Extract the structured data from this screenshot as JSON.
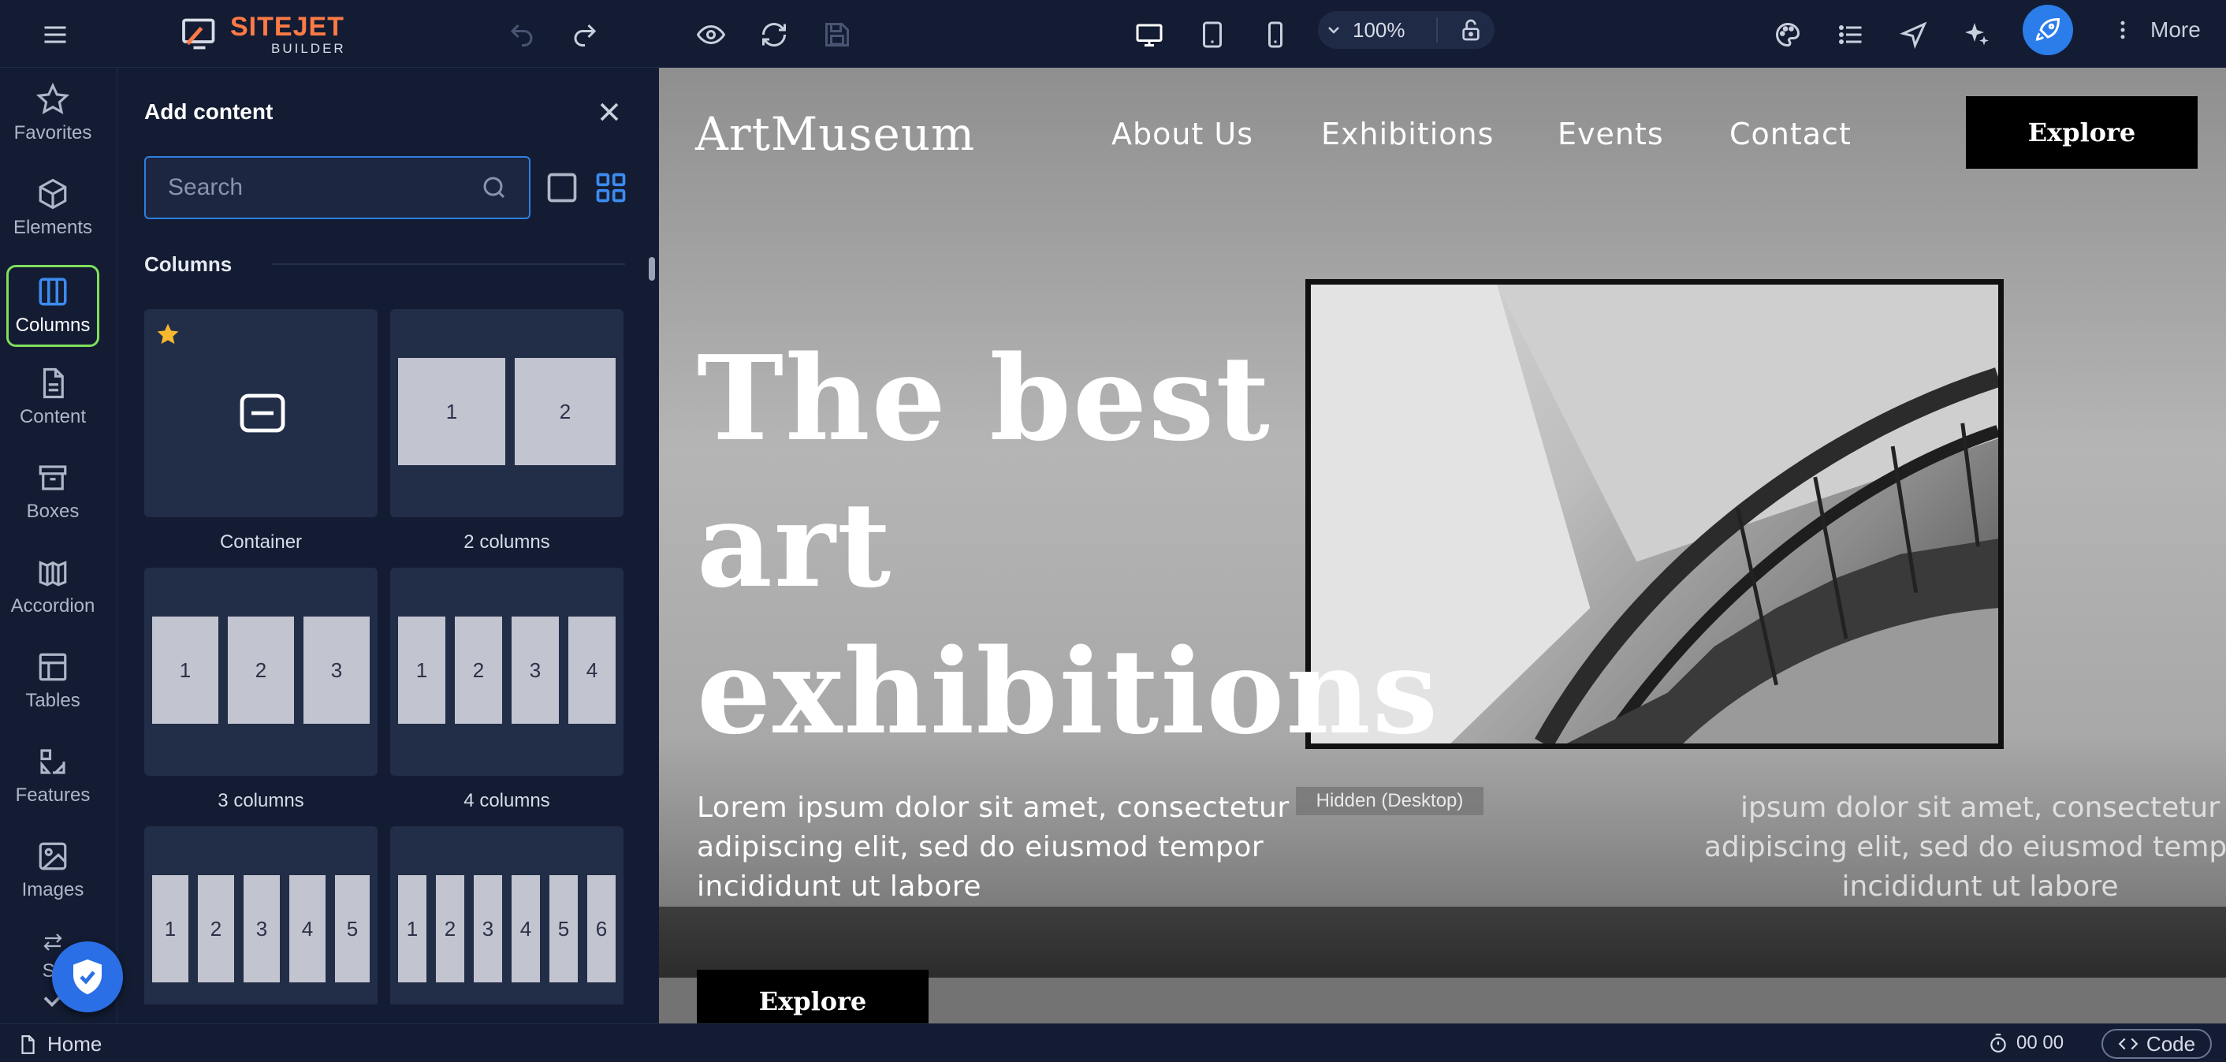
{
  "app": {
    "logo_main": "SITEJET",
    "logo_sub": "BUILDER",
    "zoom": "100%",
    "more_label": "More"
  },
  "sidebar": {
    "items": [
      {
        "label": "Favorites",
        "icon": "star-icon"
      },
      {
        "label": "Elements",
        "icon": "cube-icon"
      },
      {
        "label": "Columns",
        "icon": "columns-icon",
        "active": true
      },
      {
        "label": "Content",
        "icon": "document-icon"
      },
      {
        "label": "Boxes",
        "icon": "box-icon"
      },
      {
        "label": "Accordion",
        "icon": "accordion-icon"
      },
      {
        "label": "Tables",
        "icon": "table-icon"
      },
      {
        "label": "Features",
        "icon": "features-icon"
      },
      {
        "label": "Images",
        "icon": "image-icon"
      },
      {
        "label": "Sli",
        "icon": "slider-icon"
      }
    ]
  },
  "panel": {
    "title": "Add content",
    "search_placeholder": "Search",
    "section": "Columns",
    "tiles": [
      {
        "label": "Container"
      },
      {
        "label": "2 columns"
      },
      {
        "label": "3 columns"
      },
      {
        "label": "4 columns"
      },
      {
        "label": ""
      },
      {
        "label": ""
      }
    ],
    "column_numbers": [
      "1",
      "2",
      "3",
      "4",
      "5",
      "6"
    ]
  },
  "canvas": {
    "site_logo": "ArtMuseum",
    "nav": [
      "About Us",
      "Exhibitions",
      "Events",
      "Contact"
    ],
    "explore_top": "Explore",
    "hero_line1": "The best",
    "hero_line2": "art",
    "hero_line3": "exhibitions",
    "hero_text": "Lorem ipsum dolor sit amet, consectetur adipiscing elit, sed do eiusmod tempor incididunt ut labore",
    "hero_text_dup": "ipsum dolor sit amet, consectetur adipiscing elit, sed do eiusmod tempor incididunt ut labore",
    "hidden_badge": "Hidden (Desktop)",
    "explore_bottom": "Explore"
  },
  "status": {
    "page": "Home",
    "timer": "00 00",
    "code": "Code"
  },
  "colors": {
    "accent": "#2b7de9",
    "logo": "#ff7a45",
    "active_border": "#7fe05b",
    "star": "#f5b82e"
  }
}
